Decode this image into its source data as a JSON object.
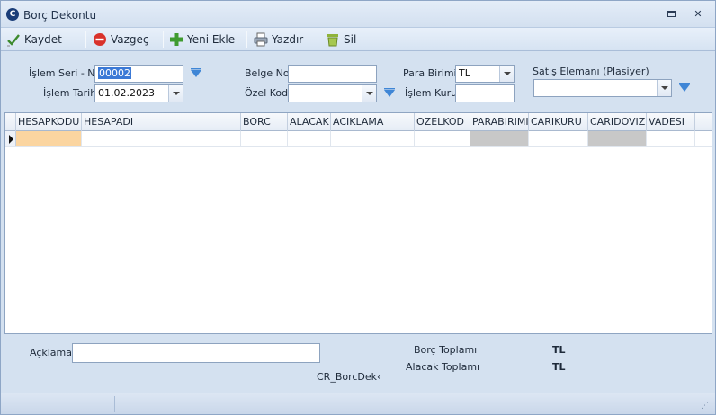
{
  "window": {
    "title": "Borç Dekontu",
    "icon_letter": "C"
  },
  "toolbar": {
    "save_label": "Kaydet",
    "cancel_label": "Vazgeç",
    "new_label": "Yeni Ekle",
    "print_label": "Yazdır",
    "delete_label": "Sil"
  },
  "form": {
    "seri_no_label": "İşlem Seri - No",
    "seri_no_value": "00002",
    "tarih_label": "İşlem Tarihi",
    "tarih_value": "01.02.2023",
    "belge_no_label": "Belge No",
    "belge_no_value": "",
    "ozel_kod_label": "Özel Kod",
    "ozel_kod_value": "",
    "para_birimi_label": "Para Birimi",
    "para_birimi_value": "TL",
    "islem_kuru_label": "İşlem Kuru",
    "islem_kuru_value": "",
    "satis_elemani_label": "Satış Elemanı (Plasiyer)",
    "satis_elemani_value": ""
  },
  "grid": {
    "columns": [
      "HESAPKODU",
      "HESAPADI",
      "BORC",
      "ALACAK",
      "ACIKLAMA",
      "OZELKOD",
      "PARABIRIMI",
      "CARIKURU",
      "CARIDOVIZI",
      "VADESI"
    ]
  },
  "footer": {
    "aciklama_label": "Açklama",
    "aciklama_value": "",
    "form_code": "CR_BorcDek‹",
    "borc_toplami_label": "Borç Toplamı",
    "borc_toplami_value": "TL",
    "alacak_toplami_label": "Alacak Toplamı",
    "alacak_toplami_value": "TL"
  },
  "colors": {
    "accent": "#3b79d6",
    "window_bg": "#d4e1f0",
    "highlight_cell": "#fbd5a0",
    "readonly_cell": "#c8c8c8"
  }
}
